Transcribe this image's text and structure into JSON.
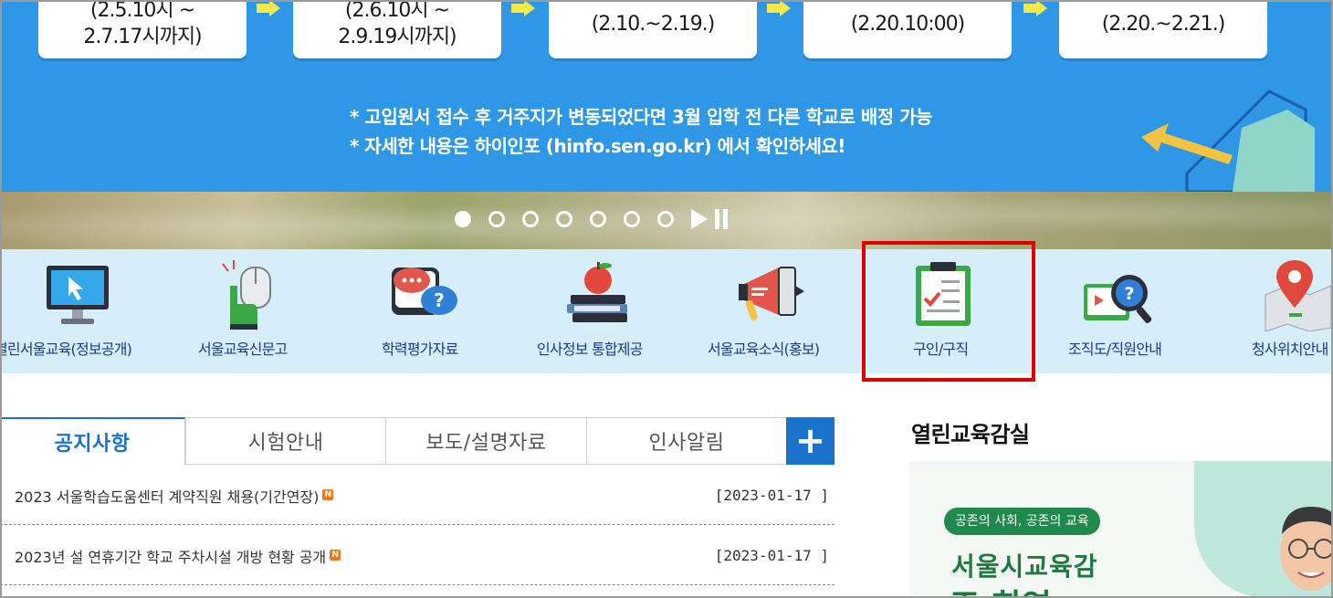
{
  "banner": {
    "steps": [
      {
        "line1": "(2.5.10시 ~",
        "line2": "2.7.17시까지)"
      },
      {
        "line1": "(2.6.10시 ~",
        "line2": "2.9.19시까지)"
      },
      {
        "line1": "(2.10.~2.19.)",
        "line2": ""
      },
      {
        "line1": "(2.20.10:00)",
        "line2": ""
      },
      {
        "line1": "(2.20.~2.21.)",
        "line2": ""
      }
    ],
    "notes": [
      "* 고입원서 접수 후 거주지가  변동되었다면 3월 입학 전 다른 학교로 배정 가능",
      "* 자세한 내용은 하이인포 (hinfo.sen.go.kr) 에서 확인하세요!"
    ],
    "background_color": "#2e97e6"
  },
  "slider": {
    "dot_count": 7,
    "active_index": 0
  },
  "quick_menu": {
    "items": [
      {
        "label": "열린서울교육(정보공개)",
        "icon": "monitor-icon"
      },
      {
        "label": "서울교육신문고",
        "icon": "hand-click-icon"
      },
      {
        "label": "학력평가자료",
        "icon": "chat-question-icon"
      },
      {
        "label": "인사정보 통합제공",
        "icon": "books-apple-icon"
      },
      {
        "label": "서울교육소식(홍보)",
        "icon": "megaphone-icon"
      },
      {
        "label": "구인/구직",
        "icon": "clipboard-check-icon"
      },
      {
        "label": "조직도/직원안내",
        "icon": "magnifier-question-icon"
      },
      {
        "label": "청사위치안내",
        "icon": "map-pin-icon"
      }
    ],
    "highlight_color": "#e00000"
  },
  "tabs": {
    "items": [
      "공지사항",
      "시험안내",
      "보도/설명자료",
      "인사알림"
    ],
    "active_index": 0,
    "more_label": "+"
  },
  "notices": [
    {
      "title": "2023 서울학습도움센터 계약직원 채용(기간연장)",
      "new_badge": "N",
      "date": "[2023-01-17 ]"
    },
    {
      "title": "2023년 설 연휴기간 학교 주차시설 개방 현황 공개",
      "new_badge": "N",
      "date": "[2023-01-17 ]"
    }
  ],
  "panel": {
    "title": "열린교육감실",
    "pill": "공존의 사회, 공존의 교육",
    "headline": "서울시교육감",
    "headline2": "조 희연"
  }
}
